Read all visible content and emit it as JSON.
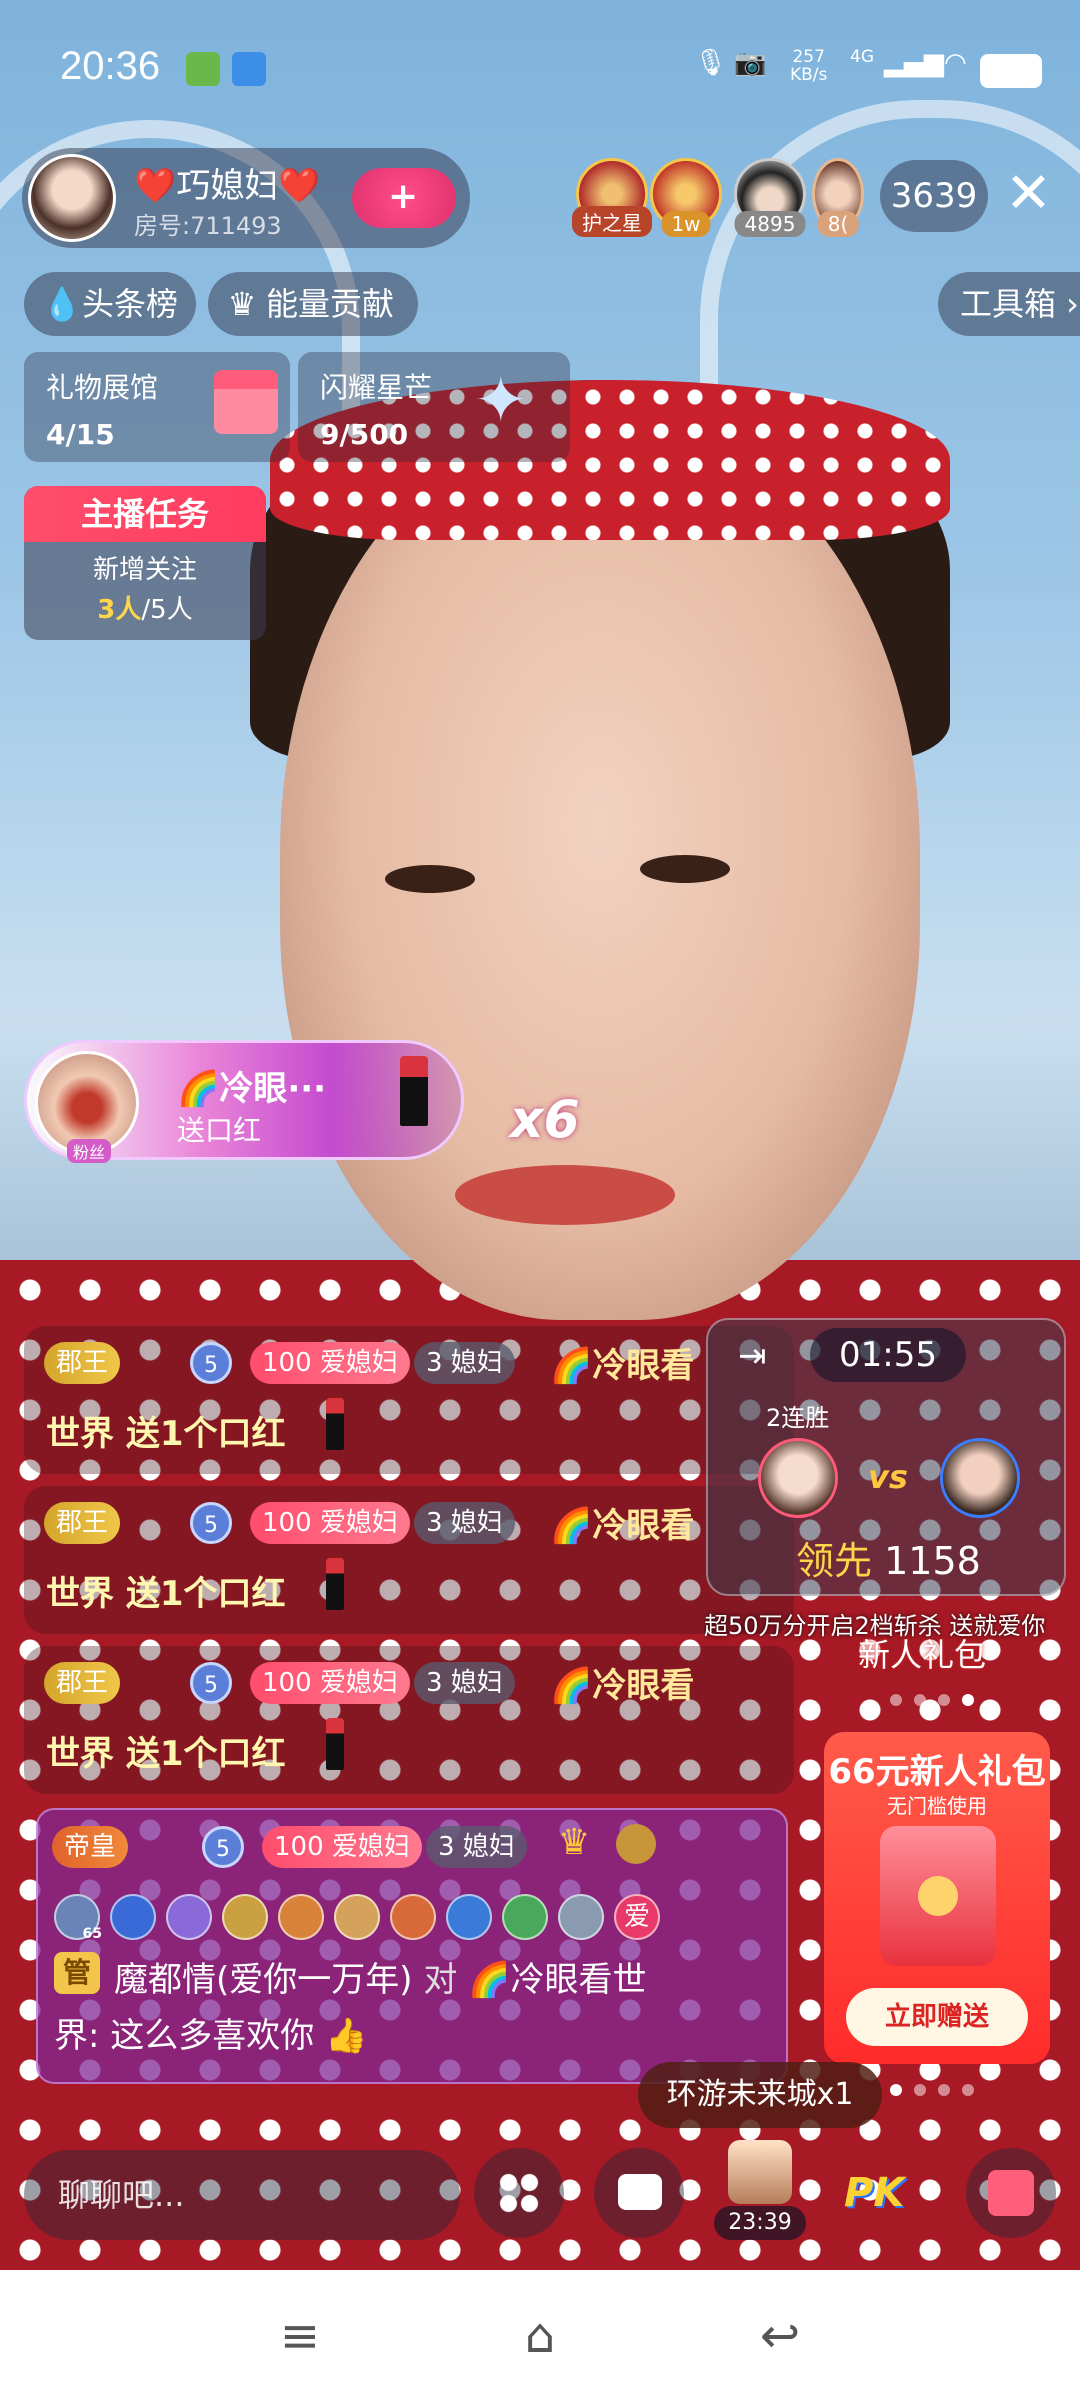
{
  "status_bar": {
    "time": "20:36",
    "net_speed": "257",
    "net_unit": "KB/s",
    "network": "4G"
  },
  "anchor": {
    "name": "❤️巧媳妇❤️",
    "room": "房号:711493",
    "follow_label": "+"
  },
  "viewers": [
    {
      "tag": "护之星",
      "tag_color": "#b8452a"
    },
    {
      "tag": "1w",
      "tag_color": "#d9932a"
    },
    {
      "tag": "4895",
      "tag_color": "#888888"
    },
    {
      "tag": "8(",
      "tag_color": "#d9a27a"
    }
  ],
  "viewer_count": "3639",
  "close_icon": "close-icon",
  "chips": {
    "headline": "头条榜",
    "energy": "能量贡献",
    "toolbox": "工具箱 ›"
  },
  "cards": {
    "gift_hall": {
      "title": "礼物展馆",
      "value": "4/15"
    },
    "shine": {
      "title": "闪耀星芒",
      "value": "9/500"
    }
  },
  "task": {
    "title": "主播任务",
    "label": "新增关注",
    "done": "3人",
    "total": "/5人"
  },
  "gift_banner": {
    "user": "🌈冷眼···",
    "action": "送口红",
    "fan_tag": "粉丝",
    "multiplier": "x6"
  },
  "chat": [
    {
      "badge_king": "郡王",
      "badge_level": "5",
      "badge_love": "100 爱媳妇",
      "badge_wife": "3 媳妇",
      "name": "🌈冷眼看",
      "message": "世界 送1个口红"
    },
    {
      "badge_king": "郡王",
      "badge_level": "5",
      "badge_love": "100 爱媳妇",
      "badge_wife": "3 媳妇",
      "name": "🌈冷眼看",
      "message": "世界 送1个口红"
    },
    {
      "badge_king": "郡王",
      "badge_level": "5",
      "badge_love": "100 爱媳妇",
      "badge_wife": "3 媳妇",
      "name": "🌈冷眼看",
      "message": "世界 送1个口红"
    }
  ],
  "big_chat": {
    "badge_emperor": "帝皇",
    "badge_level": "5",
    "badge_love": "100 爱媳妇",
    "badge_wife": "3 媳妇",
    "manager": "管",
    "sender": "魔都情(爱你一万年)",
    "to": "对",
    "target": "🌈冷眼看世",
    "line2": "界: 这么多喜欢你 👍",
    "icon_guard_level": "65",
    "love_icon": "爱"
  },
  "pk": {
    "timer": "01:55",
    "streak": "2连胜",
    "vs": "vs",
    "lead_label": "领先",
    "lead_value": "1158"
  },
  "marquee": "超50万分开启2档斩杀   送就爱你",
  "newbie_tag": "新人礼包",
  "promo": {
    "title": "66元新人礼包",
    "subtitle": "无门槛使用",
    "button": "立即赠送"
  },
  "tooltip": "环游未来城x1",
  "bottom": {
    "input_placeholder": "聊聊吧...",
    "trip_time": "23:39"
  }
}
